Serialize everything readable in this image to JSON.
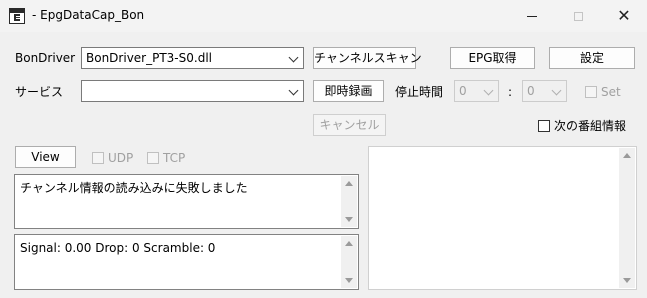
{
  "window": {
    "title": "- EpgDataCap_Bon",
    "minimize_icon": "minimize-icon",
    "maximize_icon": "maximize-icon",
    "close_icon": "close-icon",
    "close_glyph": "✕"
  },
  "row1": {
    "bondriver_label": "BonDriver",
    "bondriver_value": "BonDriver_PT3-S0.dll",
    "channel_scan_button": "チャンネルスキャン",
    "epg_button": "EPG取得",
    "settings_button": "設定"
  },
  "row2": {
    "service_label": "サービス",
    "service_value": "",
    "record_now_button": "即時録画",
    "stop_time_label": "停止時間",
    "hour_value": "0",
    "colon": ":",
    "minute_value": "0",
    "set_checkbox_label": "Set",
    "set_checked": false
  },
  "row3": {
    "cancel_button": "キャンセル",
    "next_program_label": "次の番組情報",
    "next_program_checked": false
  },
  "row4": {
    "view_button": "View",
    "udp_label": "UDP",
    "tcp_label": "TCP"
  },
  "log": {
    "message": "チャンネル情報の読み込みに失敗しました"
  },
  "status": {
    "text": "Signal: 0.00 Drop: 0 Scramble: 0"
  },
  "colors": {
    "window_bg": "#f0f0f0",
    "field_bg": "#ffffff",
    "disabled_text": "#a0a0a0"
  }
}
